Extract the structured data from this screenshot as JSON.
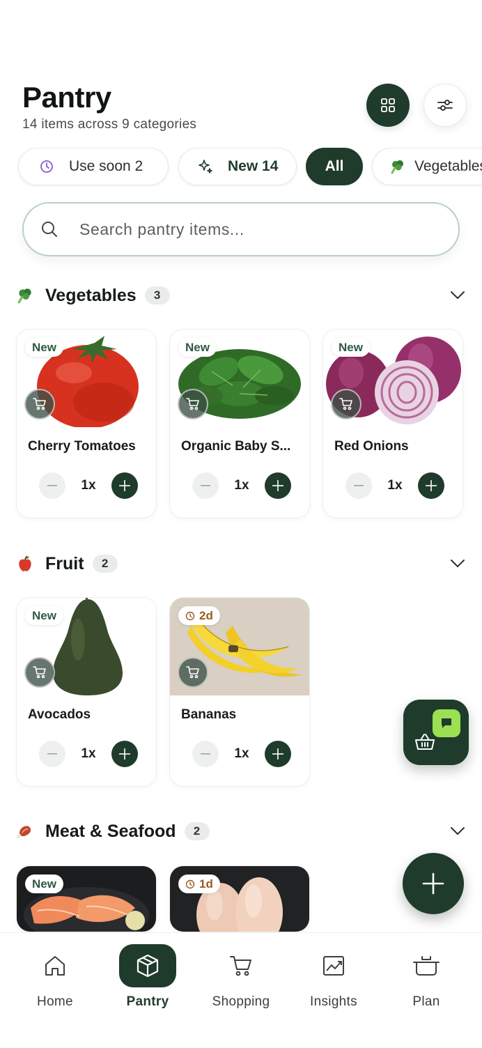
{
  "header": {
    "title": "Pantry",
    "subtitle": "14 items across 9 categories"
  },
  "filters": {
    "use_soon": "Use soon 2",
    "new": "New 14",
    "all": "All",
    "vegetables": "Vegetables"
  },
  "search": {
    "placeholder": "Search pantry items..."
  },
  "sections": [
    {
      "name": "Vegetables",
      "count": "3",
      "emoji": "broccoli-icon",
      "items": [
        {
          "name": "Cherry Tomatoes",
          "badge": "New",
          "qty": "1x"
        },
        {
          "name": "Organic Baby S...",
          "badge": "New",
          "qty": "1x"
        },
        {
          "name": "Red Onions",
          "badge": "New",
          "qty": "1x"
        }
      ]
    },
    {
      "name": "Fruit",
      "count": "2",
      "emoji": "apple-icon",
      "items": [
        {
          "name": "Avocados",
          "badge": "New",
          "qty": "1x"
        },
        {
          "name": "Bananas",
          "badge": "2d",
          "qty": "1x"
        }
      ]
    },
    {
      "name": "Meat & Seafood",
      "count": "2",
      "emoji": "meat-icon",
      "items": [
        {
          "name": "",
          "badge": "New"
        },
        {
          "name": "",
          "badge": "1d"
        }
      ]
    }
  ],
  "tabs": [
    {
      "label": "Home",
      "icon": "home-icon"
    },
    {
      "label": "Pantry",
      "icon": "box-icon",
      "active": true
    },
    {
      "label": "Shopping",
      "icon": "cart-icon"
    },
    {
      "label": "Insights",
      "icon": "chart-icon"
    },
    {
      "label": "Plan",
      "icon": "pot-icon"
    }
  ],
  "colors": {
    "primary": "#1f3b2b",
    "accent": "#9be052",
    "soon": "#8a5cc9",
    "warning": "#9a5a20"
  }
}
